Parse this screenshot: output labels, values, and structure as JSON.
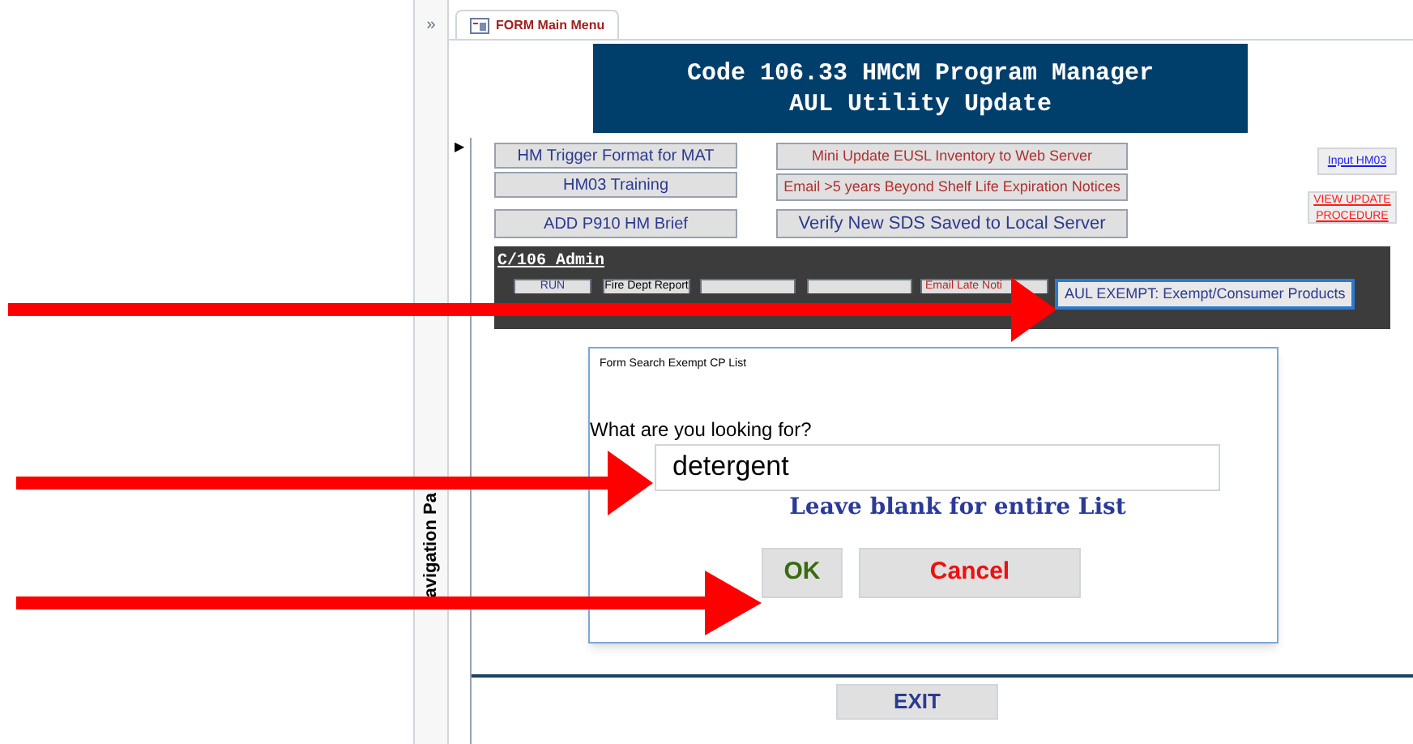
{
  "nav_pane": {
    "expand_glyph": "»",
    "title": "avigation Pa"
  },
  "tab": {
    "label": "FORM Main Menu",
    "selected": true
  },
  "header": {
    "lines": [
      "Code 106.33 HMCM Program Manager",
      "AUL Utility Update"
    ]
  },
  "record_selector": "▶",
  "left_buttons": [
    "HM Trigger Format for MAT",
    "HM03 Training",
    "ADD P910 HM Brief"
  ],
  "middle_buttons": [
    {
      "label": "Mini Update EUSL Inventory to Web Server",
      "kind": "red"
    },
    {
      "label": "Email >5 years Beyond Shelf Life Expiration Notices",
      "kind": "red"
    },
    {
      "label": "Verify New SDS Saved to Local Server",
      "kind": "navy"
    }
  ],
  "links": [
    {
      "label": "Input HM03",
      "kind": "blue"
    },
    {
      "label": "VIEW UPDATE PROCEDURE",
      "kind": "red"
    }
  ],
  "admin": {
    "title": "C/106 Admin",
    "buttons": [
      {
        "label": "RUN",
        "selected": false
      },
      {
        "label": "Fire Dept Report",
        "selected": false
      },
      {
        "selected": false
      },
      {
        "selected": false
      },
      {
        "label": "Email Late Noti",
        "selected": false
      },
      {
        "label": "AUL EXEMPT: Exempt/Consumer Products",
        "selected": true
      }
    ]
  },
  "dialog": {
    "title": "Form Search Exempt CP List",
    "prompt": "What are you looking for?",
    "value": "detergent",
    "hint": "Leave blank for entire List",
    "ok": "OK",
    "cancel": "Cancel"
  },
  "exit": "EXIT"
}
